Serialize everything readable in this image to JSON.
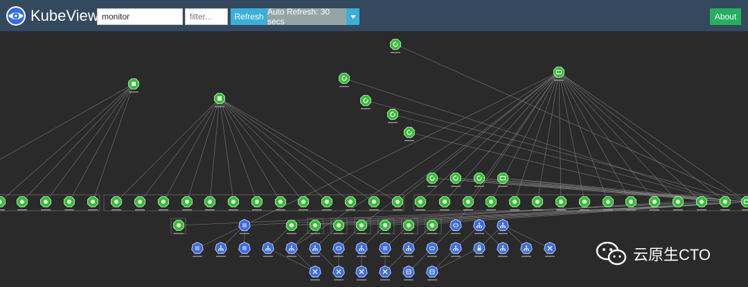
{
  "app": {
    "title": "KubeView"
  },
  "toolbar": {
    "namespace_value": "monitor",
    "filter_placeholder": "filter...",
    "refresh_label": "Refresh",
    "auto_refresh_label": "Auto Refresh: 30 secs",
    "about_label": "About"
  },
  "colors": {
    "navbar": "#34495e",
    "canvas": "#2a2a2a",
    "pod": "#2ec22e",
    "service": "#3c6ce6",
    "refresh": "#3bafda",
    "about": "#27ae60",
    "edge": "#8a8a8a"
  },
  "graph": {
    "node_types": {
      "G": {
        "kind": "green",
        "glyph": "cube-icon"
      },
      "R": {
        "kind": "green",
        "glyph": "refresh-icon"
      },
      "P": {
        "kind": "green",
        "glyph": "pod-icon"
      },
      "M": {
        "kind": "green",
        "glyph": "monitor-icon"
      },
      "L": {
        "kind": "blue",
        "glyph": "list-icon"
      },
      "N": {
        "kind": "blue",
        "glyph": "network-icon"
      },
      "E": {
        "kind": "blue",
        "glyph": "ellipse-icon"
      },
      "X": {
        "kind": "blue",
        "glyph": "shuffle-icon"
      },
      "K": {
        "kind": "blue",
        "glyph": "lock-icon"
      },
      "C": {
        "kind": "blue",
        "glyph": "database-icon"
      }
    }
  },
  "watermark": {
    "text": "云原生CTO",
    "icon": "wechat-icon"
  }
}
